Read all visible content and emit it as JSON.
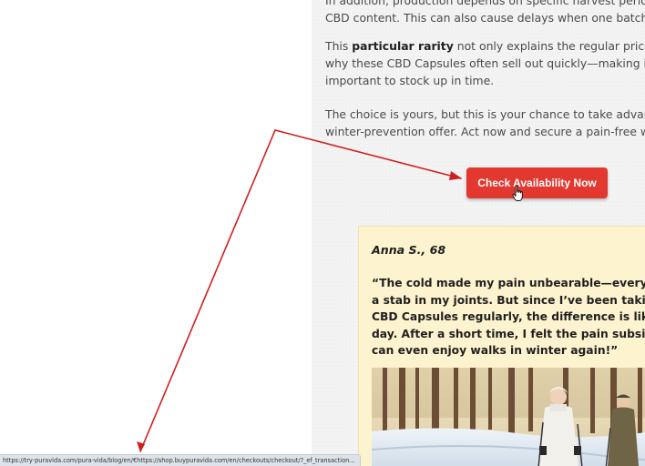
{
  "article": {
    "para0": [
      "In addition, production depends on specific harvest periods",
      "CBD content. This can also cause delays when one batch is s"
    ],
    "para1": {
      "lead": "This ",
      "bold": "particular rarity",
      "rest": " not only explains the regular price of",
      "lines": [
        "why these CBD Capsules often sell out quickly—making it all",
        "important to stock up in time."
      ]
    },
    "para2": [
      "The choice is yours, but this is your chance to take advantage",
      "winter-prevention offer. Act now and secure a pain-free wint"
    ]
  },
  "cta": {
    "label": "Check Availability Now"
  },
  "testimonial": {
    "author": "Anna S., 68",
    "quote_lines": [
      "“The cold made my pain unbearable—every ste",
      "a stab in my joints. But since I’ve been taking Pu",
      "CBD Capsules regularly, the difference is like ni",
      "day. After a short time, I felt the pain subside, a",
      "can even enjoy walks in winter again!”"
    ]
  },
  "statusbar": {
    "url": "https://try-puravida.com/pura-vida/blog/en/€https://shop.buypuravida.com/en/checkouts/checkout/?_ef_transaction..."
  },
  "colors": {
    "cta": "#e3382f",
    "annotation_arrow": "#d11e1e",
    "testimonial_bg": "#fdf3cf"
  }
}
